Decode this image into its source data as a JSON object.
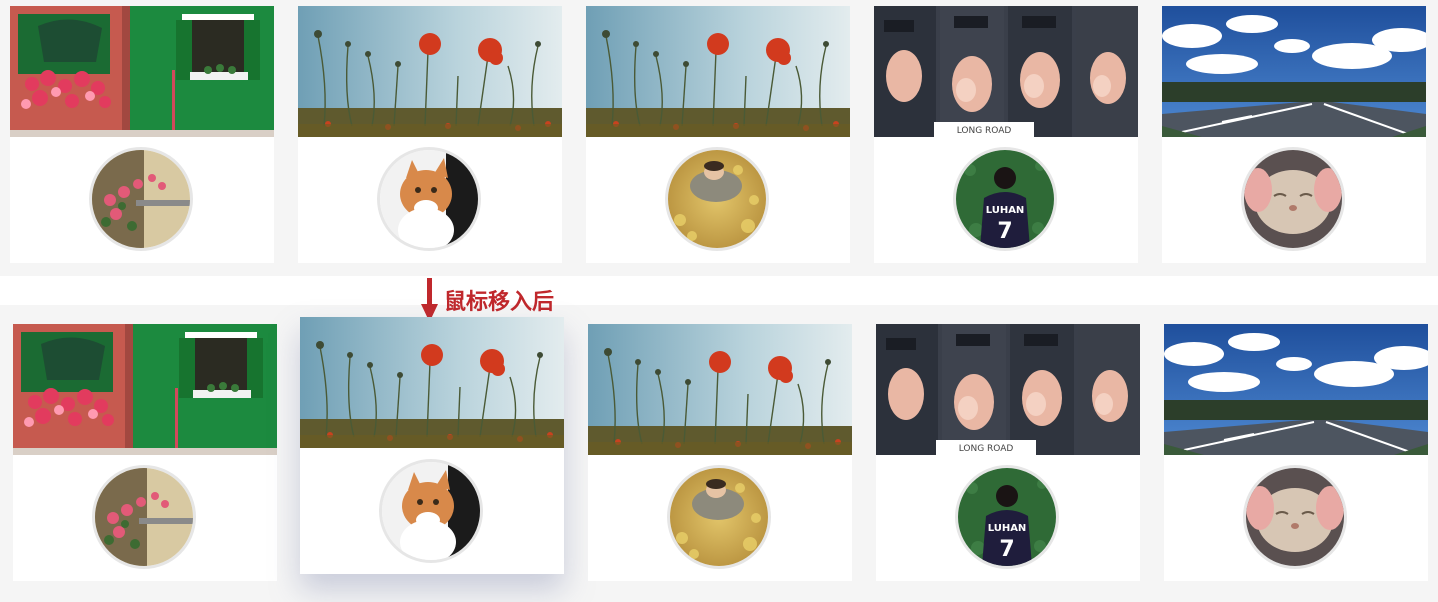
{
  "annotation": {
    "label": "鼠标移入后",
    "color": "#c0282c"
  },
  "rows": [
    {
      "state": "default",
      "cards": [
        {
          "cover": "green-house-window-flowers",
          "avatar": "flower-box-balcony"
        },
        {
          "cover": "red-poppies-sky",
          "avatar": "orange-white-cat"
        },
        {
          "cover": "red-poppies-sky",
          "avatar": "person-lying-leaves"
        },
        {
          "cover": "hooded-person-collage",
          "avatar": "luhan-7-jersey"
        },
        {
          "cover": "open-road-blue-sky",
          "avatar": "squished-cat-face"
        }
      ]
    },
    {
      "state": "hover",
      "hovered_index": 1,
      "cards": [
        {
          "cover": "green-house-window-flowers",
          "avatar": "flower-box-balcony"
        },
        {
          "cover": "red-poppies-sky",
          "avatar": "orange-white-cat"
        },
        {
          "cover": "red-poppies-sky",
          "avatar": "person-lying-leaves"
        },
        {
          "cover": "hooded-person-collage",
          "avatar": "luhan-7-jersey"
        },
        {
          "cover": "open-road-blue-sky",
          "avatar": "squished-cat-face"
        }
      ]
    }
  ]
}
